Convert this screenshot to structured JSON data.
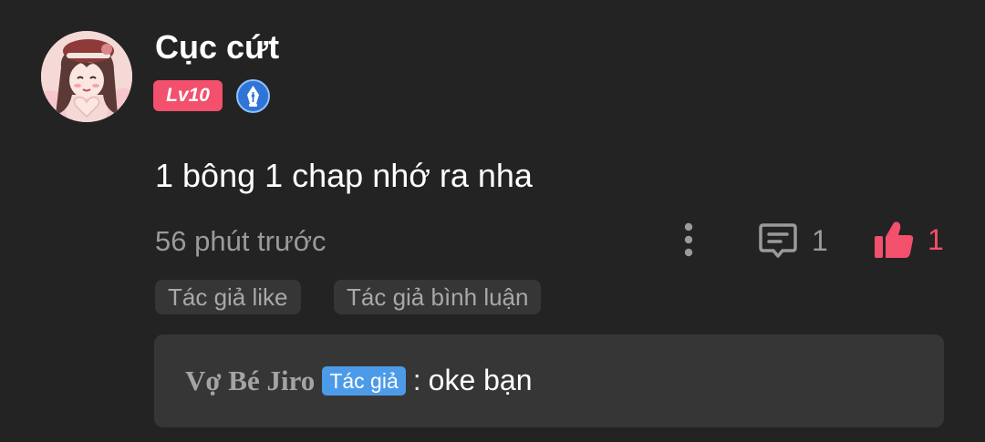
{
  "comment": {
    "author": {
      "name": "Cục cứt",
      "level": "Lv10",
      "avatar_icon": "anime-girl-avatar",
      "badge_icon": "pen-nib-badge-icon"
    },
    "text": "1 bông 1 chap nhớ ra nha",
    "timestamp": "56 phút trước",
    "actions": {
      "more_icon": "more-vertical-icon",
      "reply_icon": "comment-icon",
      "reply_count": "1",
      "like_icon": "thumbs-up-icon",
      "like_count": "1"
    },
    "tags": [
      "Tác giả like",
      "Tác giả bình luận"
    ],
    "reply": {
      "author": "Vợ Bé Jiro",
      "badge": "Tác giả",
      "separator": ":",
      "text": "oke bạn"
    }
  },
  "colors": {
    "background": "#232323",
    "level_badge": "#f2506d",
    "like": "#f2506d",
    "author_badge": "#4c9be8",
    "muted_text": "#9a9a9a",
    "tag_background": "#363636"
  }
}
